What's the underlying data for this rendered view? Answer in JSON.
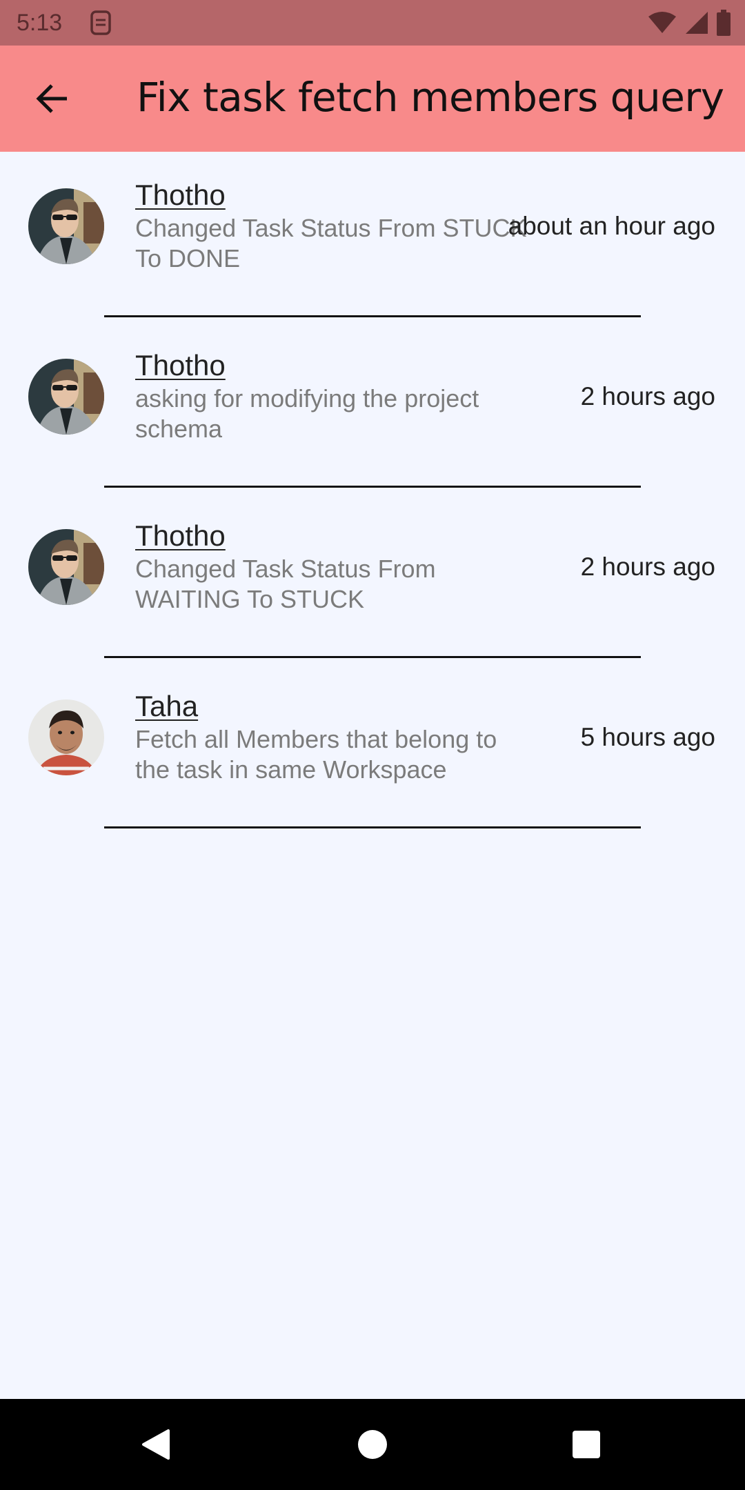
{
  "status_bar": {
    "time": "5:13",
    "icons": [
      "sim-card-icon",
      "wifi-icon",
      "signal-icon",
      "battery-icon"
    ]
  },
  "app_bar": {
    "title": "Fix task fetch members query",
    "back_icon": "arrow-back-icon",
    "background": "#f88a8a"
  },
  "feed": {
    "items": [
      {
        "name": "Thotho",
        "description": "Changed Task Status From STUCK To DONE",
        "time": "about an hour ago",
        "avatar": "user-photo-thotho"
      },
      {
        "name": "Thotho",
        "description": "asking for modifying the project schema",
        "time": "2 hours ago",
        "avatar": "user-photo-thotho"
      },
      {
        "name": "Thotho",
        "description": "Changed Task Status From WAITING To STUCK",
        "time": "2 hours ago",
        "avatar": "user-photo-thotho"
      },
      {
        "name": "Taha",
        "description": "Fetch all Members that belong to the task in same Workspace",
        "time": "5 hours ago",
        "avatar": "user-photo-taha"
      }
    ]
  },
  "nav_bar": {
    "icons": [
      "back-triangle-icon",
      "home-circle-icon",
      "recents-square-icon"
    ]
  }
}
